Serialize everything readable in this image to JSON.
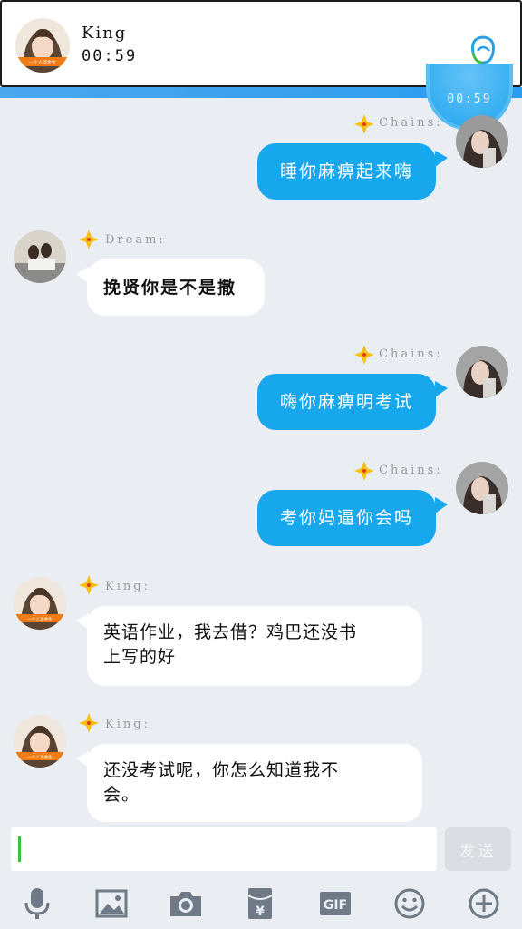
{
  "header": {
    "contact_name": "King",
    "call_time": "00:59",
    "avatar_caption": "一个人流余生"
  },
  "floating_timer": "00:59",
  "messages": [
    {
      "side": "right",
      "sender": "Chains:",
      "text": "睡你麻痹起来嗨"
    },
    {
      "side": "left",
      "sender": "Dream:",
      "text": "挽贤你是不是撒"
    },
    {
      "side": "right",
      "sender": "Chains:",
      "text": "嗨你麻痹明考试"
    },
    {
      "side": "right",
      "sender": "Chains:",
      "text": "考你妈逼你会吗"
    },
    {
      "side": "left",
      "sender": "King:",
      "text_line1": "英语作业，我去借？鸡巴还没书",
      "text_line2": "上写的好",
      "avatar_caption": "一个人流余生"
    },
    {
      "side": "left",
      "sender": "King:",
      "text_line1": "还没考试呢，你怎么知道我不",
      "text_line2": "会。",
      "avatar_caption": "一个人流余生"
    }
  ],
  "input": {
    "value": ""
  },
  "send_label": "发送",
  "toolbar": [
    {
      "icon": "microphone-icon"
    },
    {
      "icon": "image-icon"
    },
    {
      "icon": "camera-icon"
    },
    {
      "icon": "red-packet-icon"
    },
    {
      "icon": "gif-icon",
      "label": "GIF"
    },
    {
      "icon": "emoji-icon"
    },
    {
      "icon": "plus-icon"
    }
  ],
  "colors": {
    "accent": "#16a7ec",
    "background": "#eaeef3",
    "star": "#f5c116"
  }
}
